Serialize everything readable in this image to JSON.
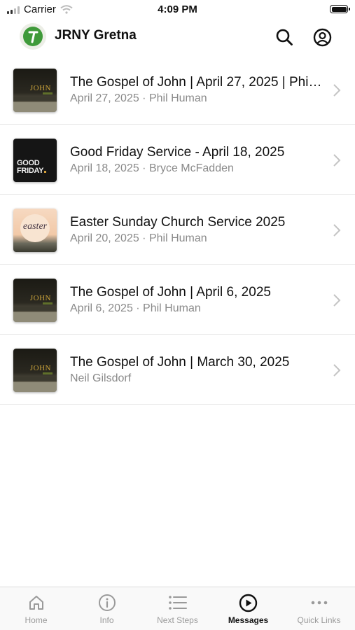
{
  "status_bar": {
    "carrier": "Carrier",
    "time": "4:09 PM"
  },
  "header": {
    "title": "JRNY Gretna",
    "logo_icon": "jrny-logo-icon",
    "search_icon": "search-icon",
    "profile_icon": "account-circle-icon"
  },
  "messages": [
    {
      "title": "The Gospel of John  |  April 27, 2025 | Phil Human",
      "subtitle": "April 27, 2025 · Phil Human",
      "thumb": "john"
    },
    {
      "title": "Good Friday Service - April 18, 2025",
      "subtitle": "April 18, 2025 · Bryce McFadden",
      "thumb": "friday"
    },
    {
      "title": "Easter Sunday Church Service 2025",
      "subtitle": "April 20, 2025 · Phil Human",
      "thumb": "easter"
    },
    {
      "title": "The Gospel of John  |  April 6, 2025",
      "subtitle": "April 6, 2025 · Phil Human",
      "thumb": "john"
    },
    {
      "title": "The Gospel of John  |  March 30, 2025",
      "subtitle": "Neil Gilsdorf",
      "thumb": "john"
    }
  ],
  "thumb_text": {
    "john": "JOHN",
    "good": "GOOD",
    "friday": "FRIDAY",
    "easter": "easter"
  },
  "tabs": [
    {
      "label": "Home",
      "icon": "home-icon"
    },
    {
      "label": "Info",
      "icon": "info-icon"
    },
    {
      "label": "Next Steps",
      "icon": "list-icon"
    },
    {
      "label": "Messages",
      "icon": "play-circle-icon",
      "active": true
    },
    {
      "label": "Quick Links",
      "icon": "more-icon"
    }
  ],
  "colors": {
    "accent": "#3f9a3a",
    "active_tab": "#111111",
    "inactive_tab": "#9a9a9a",
    "subtitle": "#8a8a8a"
  }
}
